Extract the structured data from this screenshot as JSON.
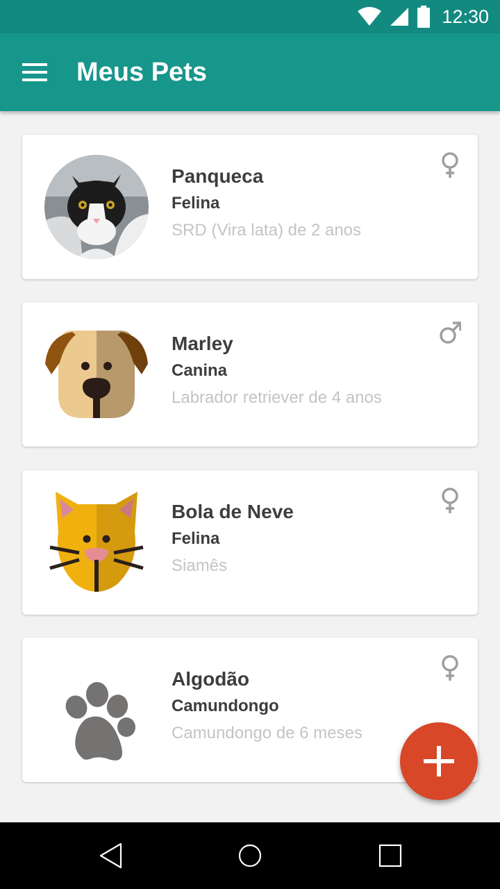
{
  "status_bar": {
    "time": "12:30",
    "icons": [
      "wifi-icon",
      "signal-icon",
      "battery-icon"
    ]
  },
  "app_bar": {
    "title": "Meus Pets",
    "menu_icon": "hamburger-menu-icon"
  },
  "pets": [
    {
      "name": "Panqueca",
      "species": "Felina",
      "description": "SRD (Vira lata) de 2 anos",
      "gender": "female",
      "avatar": "cat-photo"
    },
    {
      "name": "Marley",
      "species": "Canina",
      "description": "Labrador retriever de 4 anos",
      "gender": "male",
      "avatar": "dog-icon"
    },
    {
      "name": "Bola de Neve",
      "species": "Felina",
      "description": "Siamês",
      "gender": "female",
      "avatar": "cat-icon"
    },
    {
      "name": "Algodão",
      "species": "Camundongo",
      "description": "Camundongo de 6 meses",
      "gender": "female",
      "avatar": "paw-icon"
    }
  ],
  "fab": {
    "icon": "plus-icon",
    "color": "#d84727"
  },
  "colors": {
    "primary": "#17968b",
    "primary_dark": "#138a80",
    "accent": "#d84727"
  },
  "nav_bar": {
    "icons": [
      "back-icon",
      "home-icon",
      "recents-icon"
    ]
  }
}
